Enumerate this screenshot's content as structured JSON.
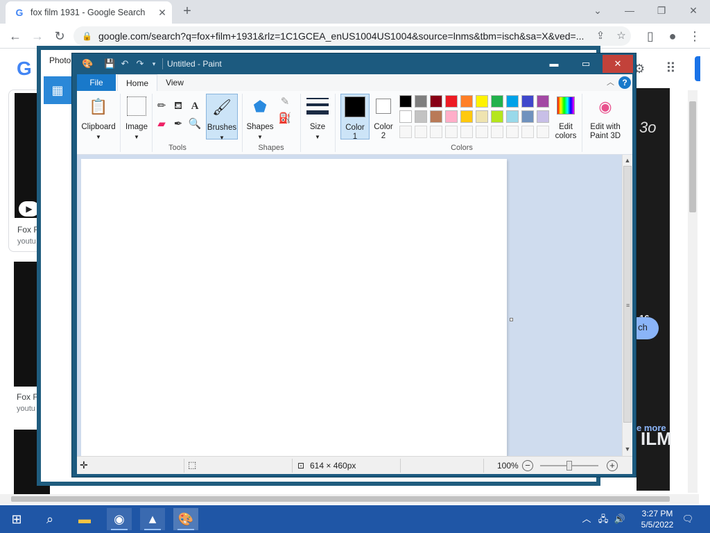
{
  "browser": {
    "tab_title": "fox film 1931 - Google Search",
    "tab_favicon": "G",
    "url": "google.com/search?q=fox+film+1931&rlz=1C1GCEA_enUS1004US1004&source=lnms&tbm=isch&sa=X&ved=..."
  },
  "google": {
    "logo": "G",
    "results": [
      {
        "title": "Fox F",
        "source": "youtu"
      },
      {
        "title": "Fox F",
        "source": "youtu"
      }
    ],
    "right_text_1": "3o",
    "right_text_2": "16",
    "pill_text": "ch",
    "see_more": "e more",
    "bottom_text": "ILM"
  },
  "photos": {
    "title": "Photo"
  },
  "paint": {
    "title": "Untitled - Paint",
    "tabs": {
      "file": "File",
      "home": "Home",
      "view": "View"
    },
    "help": "?",
    "groups": {
      "clipboard": "Clipboard",
      "image": "Image",
      "tools": "Tools",
      "brushes": "Brushes",
      "shapes": "Shapes",
      "shapes_group": "Shapes",
      "size": "Size",
      "color1": "Color",
      "color1_num": "1",
      "color2": "Color",
      "color2_num": "2",
      "colors_group": "Colors",
      "edit_colors_1": "Edit",
      "edit_colors_2": "colors",
      "paint3d_1": "Edit with",
      "paint3d_2": "Paint 3D"
    },
    "palette_row1": [
      "#000000",
      "#7f7f7f",
      "#880015",
      "#ed1c24",
      "#ff7f27",
      "#fff200",
      "#22b14c",
      "#00a2e8",
      "#3f48cc",
      "#a349a4"
    ],
    "palette_row2": [
      "#ffffff",
      "#c3c3c3",
      "#b97a57",
      "#ffaec9",
      "#ffc90e",
      "#efe4b0",
      "#b5e61d",
      "#99d9ea",
      "#7092be",
      "#c8bfe7"
    ],
    "status": {
      "size": "614 × 460px",
      "zoom": "100%"
    }
  },
  "taskbar": {
    "time": "3:27 PM",
    "date": "5/5/2022"
  }
}
